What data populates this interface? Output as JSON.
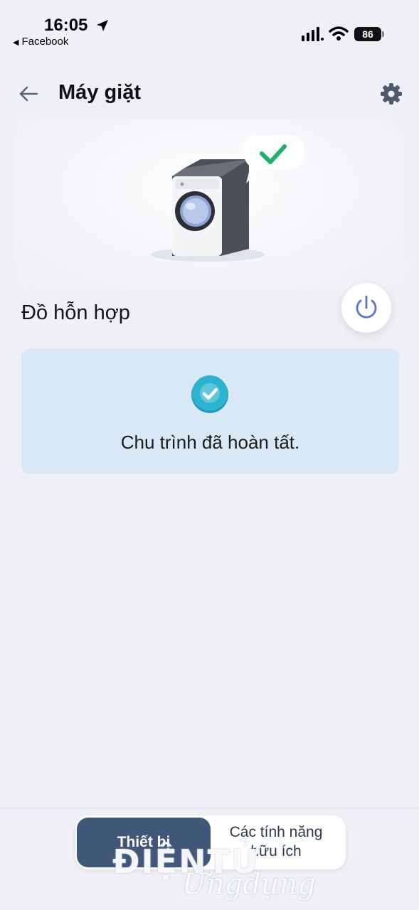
{
  "status_bar": {
    "time": "16:05",
    "back_app": "Facebook",
    "battery": "86",
    "icons": [
      "location-arrow-icon",
      "cellular-signal-icon",
      "wifi-icon",
      "battery-icon"
    ]
  },
  "header": {
    "title": "Máy giặt",
    "back_icon": "arrow-left-icon",
    "settings_icon": "gear-icon"
  },
  "device": {
    "image": "washing-machine-with-check-bubble",
    "cycle_name": "Đồ hỗn hợp",
    "power_icon": "power-icon"
  },
  "status_card": {
    "icon": "check-circle-icon",
    "message": "Chu trình đã hoàn tất."
  },
  "bottom_tabs": {
    "active_label": "Thiết bị",
    "other_line1": "Các tính năng",
    "other_line2": "hữu ích"
  },
  "watermark": {
    "line1": "ĐIỆNTỬ",
    "line2": "Ứngdụng"
  },
  "colors": {
    "background": "#eef0f5",
    "card": "#d8e8f5",
    "active_tab": "#41577a",
    "power_accent": "#5b72d6",
    "check_teal": "#2bb3cf",
    "check_green": "#1fb36a"
  }
}
